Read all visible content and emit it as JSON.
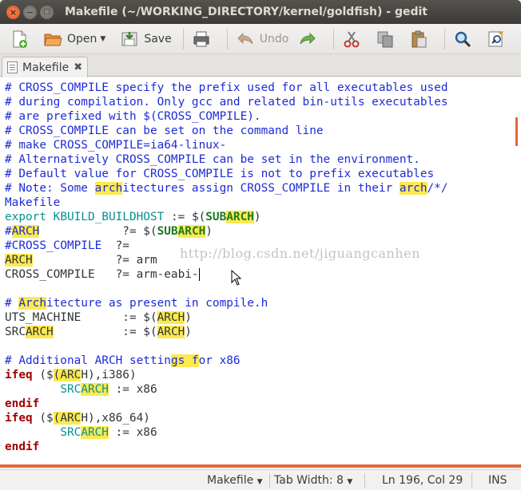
{
  "window": {
    "title": "Makefile (~/WORKING_DIRECTORY/kernel/goldfish) - gedit",
    "close_glyph": "×",
    "min_glyph": "−",
    "max_glyph": "□"
  },
  "toolbar": {
    "open_label": "Open",
    "save_label": "Save",
    "undo_label": "Undo",
    "dropdown_glyph": "▼"
  },
  "tab": {
    "label": "Makefile",
    "close_glyph": "✖"
  },
  "editor": {
    "lines": [
      "# CROSS_COMPILE specify the prefix used for all executables used",
      "# during compilation. Only gcc and related bin-utils executables",
      "# are prefixed with $(CROSS_COMPILE).",
      "# CROSS_COMPILE can be set on the command line",
      "# make CROSS_COMPILE=ia64-linux-",
      "# Alternatively CROSS_COMPILE can be set in the environment.",
      "# Default value for CROSS_COMPILE is not to prefix executables",
      "# Note: Some architectures assign CROSS_COMPILE in their arch/*/",
      "Makefile",
      "export KBUILD_BUILDHOST := $(SUBARCH)",
      "#ARCH            ?= $(SUBARCH)",
      "#CROSS_COMPILE  ?=",
      "ARCH            ?= arm",
      "CROSS_COMPILE   ?= arm-eabi-",
      "",
      "# Architecture as present in compile.h",
      "UTS_MACHINE      := $(ARCH)",
      "SRCARCH          := $(ARCH)",
      "",
      "# Additional ARCH settings for x86",
      "ifeq ($(ARCH),i386)",
      "        SRCARCH := x86",
      "endif",
      "ifeq ($(ARCH),x86_64)",
      "        SRCARCH := x86",
      "endif"
    ],
    "watermark": "http://blog.csdn.net/jiguangcanhen"
  },
  "statusbar": {
    "language": "Makefile",
    "tab_width": "Tab Width: 8",
    "position": "Ln 196, Col 29",
    "mode": "INS",
    "dropdown_glyph": "▼"
  },
  "colors": {
    "comment": "#1c2bd6",
    "keyword": "#a40000",
    "variable": "#069191",
    "highlight": "#fce94f",
    "accent": "#e06a3b"
  }
}
